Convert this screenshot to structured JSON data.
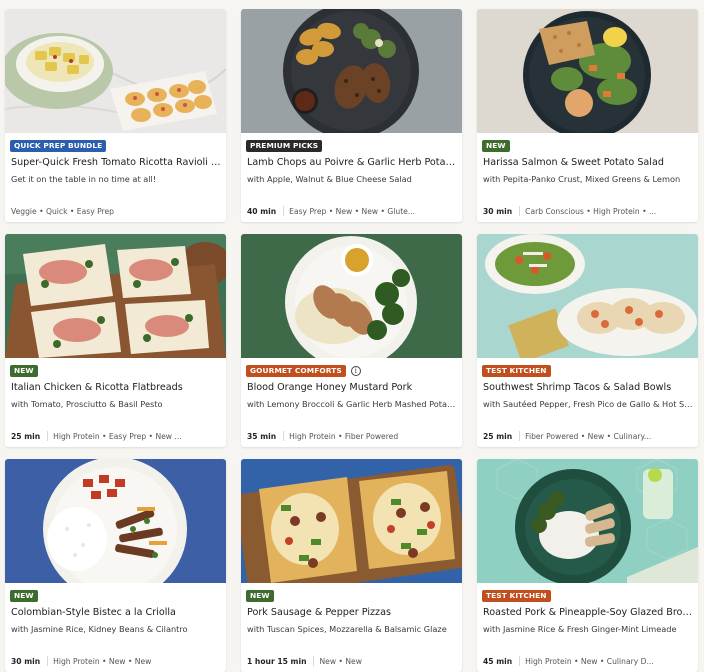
{
  "colors": {
    "badge_blue": "#2b5fad",
    "badge_dark": "#2a2a2a",
    "badge_green": "#3e6b2e",
    "badge_orange": "#c14f1d",
    "background": "#f7f5f1"
  },
  "cards": [
    {
      "badge": "QUICK PREP BUNDLE",
      "badge_color": "#2b5fad",
      "info_icon": false,
      "title": "Super-Quick Fresh Tomato Ricotta Ravioli w...",
      "subtitle": "Get it on the table in no time at all!",
      "time": "",
      "tags": "Veggie • Quick • Easy Prep",
      "image": "ravioli-and-pastry-bites"
    },
    {
      "badge": "PREMIUM PICKS",
      "badge_color": "#2a2a2a",
      "info_icon": false,
      "title": "Lamb Chops au Poivre & Garlic Herb Potat...",
      "subtitle": "with Apple, Walnut & Blue Cheese Salad",
      "time": "40 min",
      "tags": "Easy Prep • New • New • Glute...",
      "image": "lamb-chops-plate"
    },
    {
      "badge": "NEW",
      "badge_color": "#3e6b2e",
      "info_icon": false,
      "title": "Harissa Salmon & Sweet Potato Salad",
      "subtitle": "with Pepita-Panko Crust, Mixed Greens & Lemon",
      "time": "30 min",
      "tags": "Carb Conscious • High Protein • ...",
      "image": "salmon-salad-plate"
    },
    {
      "badge": "NEW",
      "badge_color": "#3e6b2e",
      "info_icon": false,
      "title": "Italian Chicken & Ricotta Flatbreads",
      "subtitle": "with Tomato, Prosciutto & Basil Pesto",
      "time": "25 min",
      "tags": "High Protein • Easy Prep • New ...",
      "image": "flatbreads-board"
    },
    {
      "badge": "GOURMET COMFORTS",
      "badge_color": "#c14f1d",
      "info_icon": true,
      "title": "Blood Orange Honey Mustard Pork",
      "subtitle": "with Lemony Broccoli & Garlic Herb Mashed Potatoes",
      "time": "35 min",
      "tags": "High Protein • Fiber Powered",
      "image": "pork-mash-broccoli-plate"
    },
    {
      "badge": "TEST KITCHEN",
      "badge_color": "#c14f1d",
      "info_icon": false,
      "title": "Southwest Shrimp Tacos & Salad Bowls",
      "subtitle": "with Sautéed Pepper, Fresh Pico de Gallo & Hot Sau...",
      "time": "25 min",
      "tags": "Fiber Powered • New • Culinary...",
      "image": "shrimp-tacos-plate"
    },
    {
      "badge": "NEW",
      "badge_color": "#3e6b2e",
      "info_icon": false,
      "title": "Colombian-Style Bistec a la Criolla",
      "subtitle": "with Jasmine Rice, Kidney Beans & Cilantro",
      "time": "30 min",
      "tags": "High Protein • New • New",
      "image": "bistec-rice-plate"
    },
    {
      "badge": "NEW",
      "badge_color": "#3e6b2e",
      "info_icon": false,
      "title": "Pork Sausage & Pepper Pizzas",
      "subtitle": "with Tuscan Spices, Mozzarella & Balsamic Glaze",
      "time": "1 hour 15 min",
      "tags": "New • New",
      "image": "sausage-pizzas-board"
    },
    {
      "badge": "TEST KITCHEN",
      "badge_color": "#c14f1d",
      "info_icon": false,
      "title": "Roasted Pork & Pineapple-Soy Glazed Broc...",
      "subtitle": "with Jasmine Rice & Fresh Ginger-Mint Limeade",
      "time": "45 min",
      "tags": "High Protein • New • Culinary D...",
      "image": "pork-rice-broccoli-plate"
    }
  ]
}
